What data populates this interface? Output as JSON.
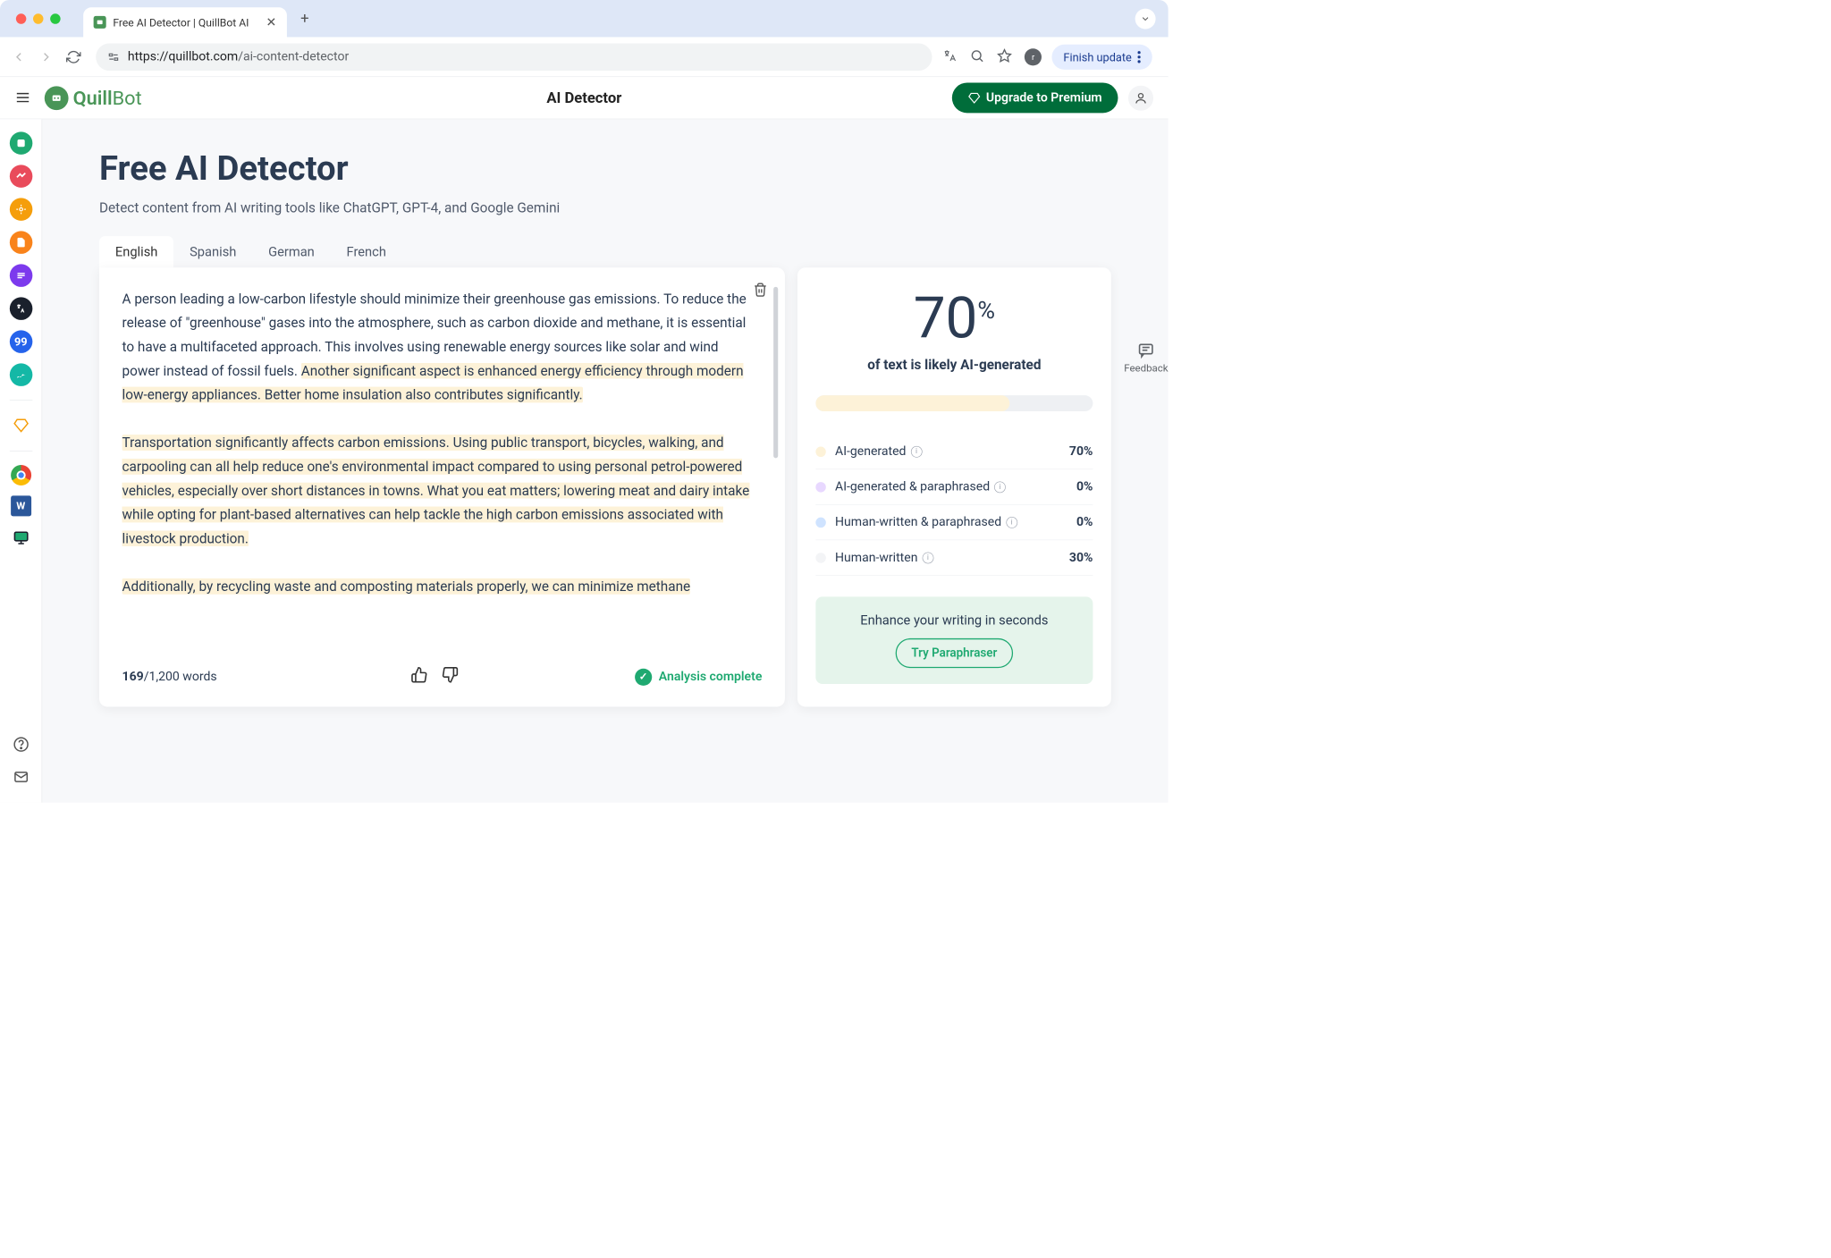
{
  "browser": {
    "tab_title": "Free AI Detector | QuillBot AI",
    "url_domain": "https://quillbot.com",
    "url_path": "/ai-content-detector",
    "finish_update": "Finish update",
    "avatar_letter": "r"
  },
  "header": {
    "logo_text_1": "Quill",
    "logo_text_2": "Bot",
    "title": "AI Detector",
    "upgrade": "Upgrade to Premium"
  },
  "page": {
    "title": "Free AI Detector",
    "subtitle": "Detect content from AI writing tools like ChatGPT, GPT-4, and Google Gemini"
  },
  "tabs": [
    "English",
    "Spanish",
    "German",
    "French"
  ],
  "editor": {
    "para1_plain": "A person leading a low-carbon lifestyle should minimize their greenhouse gas emissions. To reduce the release of \"greenhouse\" gases into the atmosphere, such as carbon dioxide and methane, it is essential to have a multifaceted approach. This involves using renewable energy sources like solar and wind power instead of fossil fuels. ",
    "para1_hl": "Another significant aspect is enhanced energy efficiency through modern low-energy appliances. Better home insulation also contributes significantly.",
    "para2_hl": "Transportation significantly affects carbon emissions. Using public transport, bicycles, walking, and carpooling can all help reduce one's environmental impact compared to using personal petrol-powered vehicles, especially over short distances in towns. What you eat matters; lowering meat and dairy intake while opting for plant-based alternatives can help tackle the high carbon emissions associated with livestock production.",
    "para3_hl": "Additionally, by recycling waste and composting materials properly, we can minimize methane",
    "word_count_current": "169",
    "word_count_sep": "/",
    "word_count_max": "1,200 words",
    "analysis_status": "Analysis complete"
  },
  "results": {
    "percent": "70",
    "percent_symbol": "%",
    "label": "of text is likely AI-generated",
    "progress_pct": 70,
    "breakdown": [
      {
        "label": "AI-generated",
        "pct": "70%",
        "dot": "dot-ai"
      },
      {
        "label": "AI-generated & paraphrased",
        "pct": "0%",
        "dot": "dot-aip"
      },
      {
        "label": "Human-written & paraphrased",
        "pct": "0%",
        "dot": "dot-hp"
      },
      {
        "label": "Human-written",
        "pct": "30%",
        "dot": "dot-h"
      }
    ],
    "enhance_text": "Enhance your writing in seconds",
    "paraphraser_btn": "Try Paraphraser"
  },
  "feedback": "Feedback"
}
